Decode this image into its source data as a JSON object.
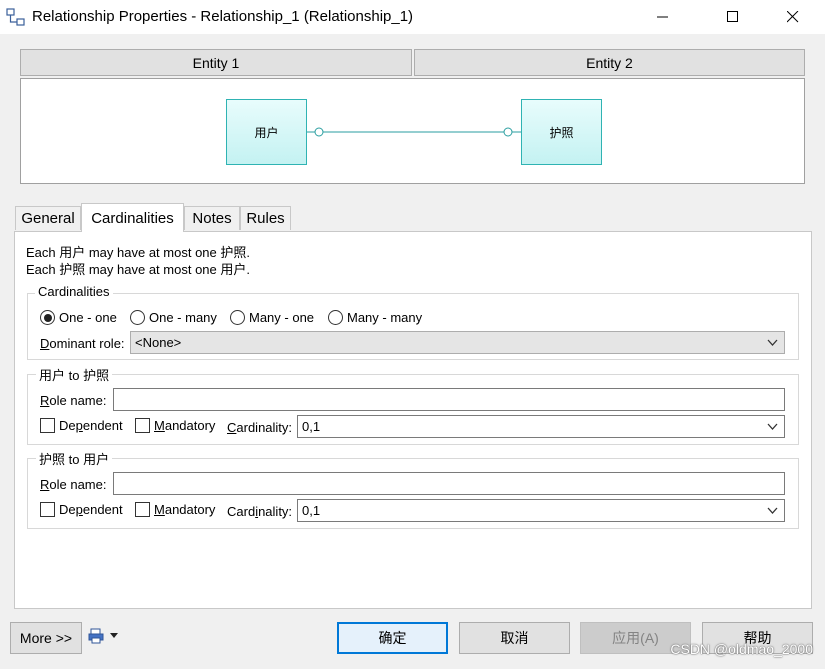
{
  "window": {
    "title": "Relationship Properties - Relationship_1 (Relationship_1)",
    "icon": "relationship-icon",
    "controls": [
      "minimize-icon",
      "maximize-icon",
      "close-icon"
    ]
  },
  "entities": {
    "entity1_header": "Entity 1",
    "entity2_header": "Entity 2",
    "entity1_name": "用户",
    "entity2_name": "护照"
  },
  "tabs": [
    {
      "label": "General",
      "active": false
    },
    {
      "label": "Cardinalities",
      "active": true
    },
    {
      "label": "Notes",
      "active": false
    },
    {
      "label": "Rules",
      "active": false
    }
  ],
  "description": {
    "line1": "Each 用户 may have at most one 护照.",
    "line2": "Each 护照 may have at most one 用户."
  },
  "cardinalities_group": {
    "title": "Cardinalities",
    "options": [
      {
        "label": "One - one",
        "selected": true
      },
      {
        "label": "One - many",
        "selected": false
      },
      {
        "label": "Many - one",
        "selected": false
      },
      {
        "label": "Many - many",
        "selected": false
      }
    ],
    "dominant_role_label_prefix": "D",
    "dominant_role_label_rest": "ominant role:",
    "dominant_role_value": "<None>"
  },
  "role1": {
    "title": "用户 to 护照",
    "role_name_prefix": "R",
    "role_name_rest": "ole name:",
    "role_name_value": "",
    "dependent_prefix": "De",
    "dependent_u": "p",
    "dependent_rest": "endent",
    "dependent_checked": false,
    "mandatory_u": "M",
    "mandatory_rest": "andatory",
    "mandatory_checked": false,
    "cardinality_prefix": "C",
    "cardinality_rest": "ardinality:",
    "cardinality_value": "0,1"
  },
  "role2": {
    "title": "护照 to 用户",
    "role_name_prefix": "R",
    "role_name_rest": "ole name:",
    "role_name_value": "",
    "dependent_prefix": "De",
    "dependent_u": "p",
    "dependent_rest": "endent",
    "dependent_checked": false,
    "mandatory_u": "M",
    "mandatory_rest": "andatory",
    "mandatory_checked": false,
    "cardinality_pre": "Card",
    "cardinality_u": "i",
    "cardinality_post": "nality:",
    "cardinality_value": "0,1"
  },
  "footer": {
    "more_label": "More >>",
    "print_icon": "print-icon",
    "ok_label": "确定",
    "cancel_label": "取消",
    "apply_label": "应用(A)",
    "help_label": "帮助"
  },
  "watermark": "CSDN @oldmao_2000",
  "colors": {
    "entity_fill": "#c4f2f2",
    "entity_border": "#2fb3b3",
    "primary_button_border": "#0078d7"
  }
}
